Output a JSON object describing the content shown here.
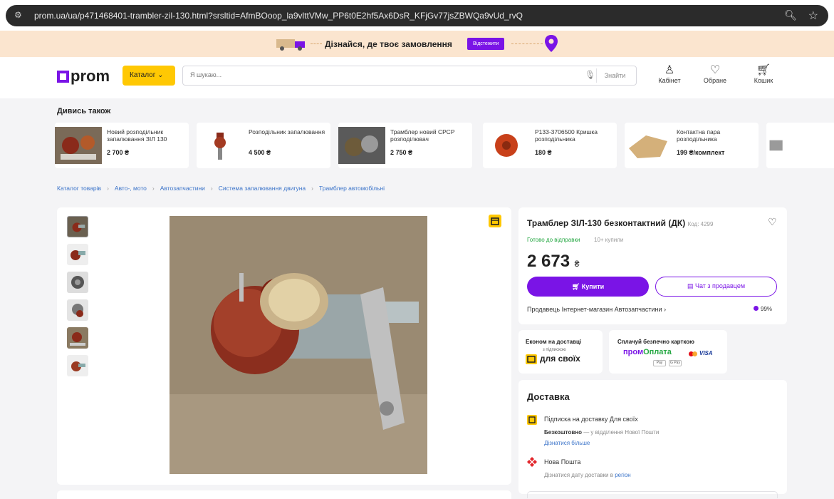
{
  "browser": {
    "url": "prom.ua/ua/p471468401-trambler-zil-130.html?srsltid=AfmBOoop_la9vlttVMw_PP6t0E2hf5Ax6DsR_KFjGv77jsZBWQa9vUd_rvQ"
  },
  "banner": {
    "text": "Дізнайся, де твоє замовлення",
    "button": "Відстежити"
  },
  "header": {
    "logo": "prom",
    "catalog_label": "Каталог",
    "search_placeholder": "Я шукаю...",
    "search_button": "Знайти",
    "cabinet": "Кабінет",
    "favorites": "Обране",
    "cart": "Кошик"
  },
  "see_also": {
    "title": "Дивись також",
    "items": [
      {
        "title": "Новий розподільник запалювання ЗІЛ 130",
        "price": "2 700 ₴"
      },
      {
        "title": "Розподільник запалювання",
        "price": "4 500 ₴"
      },
      {
        "title": "Трамблер новий СРСР розподілювач",
        "price": "2 750 ₴"
      },
      {
        "title": "Р133-3706500 Кришка розподільника",
        "price": "180 ₴"
      },
      {
        "title": "Контактна пара розподільника",
        "price": "199 ₴/комплект"
      }
    ]
  },
  "breadcrumbs": [
    "Каталог товарів",
    "Авто-, мото",
    "Автозапчастини",
    "Система запалювання двигуна",
    "Трамблер автомобільні"
  ],
  "product": {
    "title": "Трамблер ЗІЛ-130 безконтактний (ДК)",
    "code": "Код: 4299",
    "status": "Готово до відправки",
    "bought": "10+ купили",
    "price": "2 673",
    "currency": "₴",
    "buy_label": "Купити",
    "chat_label": "Чат з продавцем",
    "seller": "Продавець Інтернет-магазин Автозапчастини",
    "rating": "99%"
  },
  "promo": {
    "left_title": "Економ на доставці",
    "left_sub": "з підпискою",
    "left_big": "для своїх",
    "right_title": "Сплачуй безпечно карткою",
    "brand_a": "пром",
    "brand_b": "Оплата",
    "visa": "VISA",
    "apple_pay": "Pay",
    "google_pay": "G Pay"
  },
  "delivery": {
    "title": "Доставка",
    "sub_title": "Підписка на доставку Для своїх",
    "free": "Безкоштовно",
    "free_rest": " — у відділення Нової Пошти",
    "learn_more": "Дізнатися більше",
    "np_title": "Нова Пошта",
    "np_sub": "Дізнатися дату доставки в",
    "np_link": "регіон"
  },
  "colors": {
    "brand": "#7a14e6",
    "catalog": "#ffc803",
    "success": "#27a844",
    "link": "#3a73c9"
  }
}
